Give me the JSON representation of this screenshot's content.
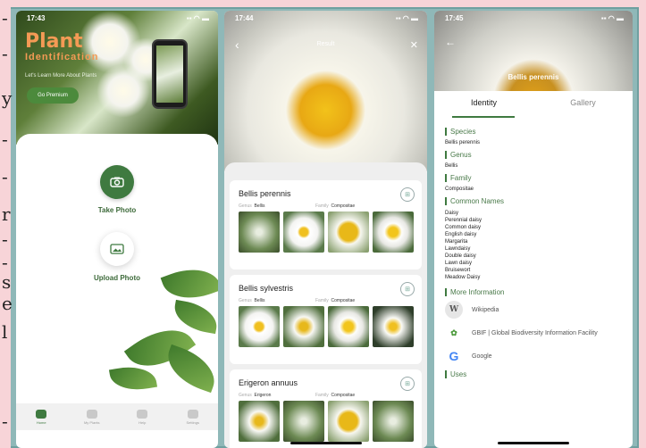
{
  "edge_chars": [
    "-",
    "-",
    "y",
    "-",
    "-",
    "r",
    "-",
    "-",
    "s",
    "e",
    "l",
    "-"
  ],
  "phone1": {
    "time": "17:43",
    "app_title": "Plant",
    "app_subtitle": "Identification",
    "tagline": "Let's Learn More About Plants",
    "premium_label": "Go Premium",
    "take_photo_label": "Take Photo",
    "upload_photo_label": "Upload Photo",
    "tabs": [
      {
        "label": "Home",
        "icon": "home-icon"
      },
      {
        "label": "My Plants",
        "icon": "plant-icon"
      },
      {
        "label": "Help",
        "icon": "help-icon"
      },
      {
        "label": "Settings",
        "icon": "gear-icon"
      }
    ]
  },
  "phone2": {
    "time": "17:44",
    "title": "Result",
    "results": [
      {
        "name": "Bellis perennis",
        "genus_label": "Genus",
        "genus": "Bellis",
        "family_label": "Family",
        "family": "Compositae"
      },
      {
        "name": "Bellis sylvestris",
        "genus_label": "Genus",
        "genus": "Bellis",
        "family_label": "Family",
        "family": "Compositae"
      },
      {
        "name": "Erigeron annuus",
        "genus_label": "Genus",
        "genus": "Erigeron",
        "family_label": "Family",
        "family": "Compositae"
      }
    ]
  },
  "phone3": {
    "time": "17:45",
    "title": "Bellis perennis",
    "tabs": [
      "Identity",
      "Gallery"
    ],
    "species_label": "Species",
    "species": "Bellis perennis",
    "genus_label": "Genus",
    "genus": "Bellis",
    "family_label": "Family",
    "family": "Compositae",
    "common_names_label": "Common Names",
    "common_names": [
      "Daisy",
      "Perennial daisy",
      "Common daisy",
      "English daisy",
      "Margarita",
      "Lawndaisy",
      "Double daisy",
      "Lawn daisy",
      "Bruisewort",
      "Meadow Daisy"
    ],
    "more_info_label": "More Information",
    "sources": [
      {
        "label": "Wikipedia",
        "icon": "wikipedia-icon"
      },
      {
        "label": "GBIF | Global Biodiversity Information Facility",
        "icon": "gbif-icon"
      },
      {
        "label": "Google",
        "icon": "google-icon"
      }
    ],
    "uses_label": "Uses"
  },
  "colors": {
    "accent": "#3f7a40",
    "brand_orange": "#f49a55",
    "background": "#f7d4d8"
  }
}
